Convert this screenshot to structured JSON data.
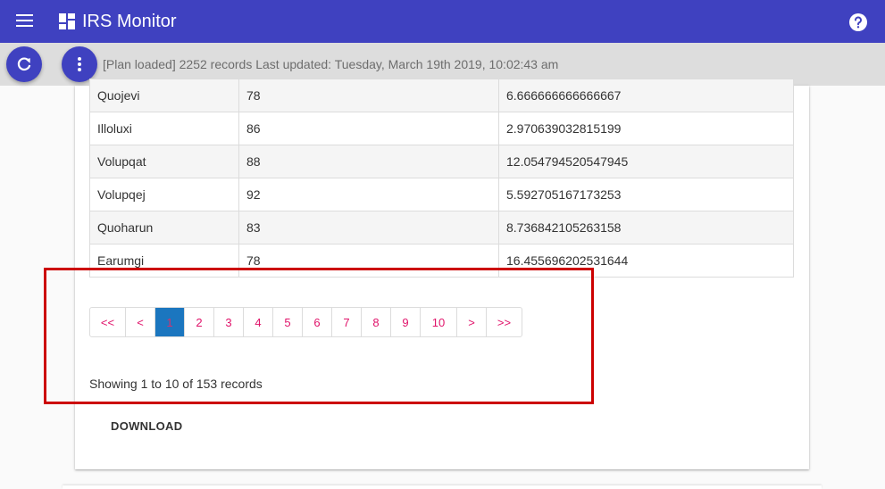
{
  "app": {
    "title": "IRS Monitor",
    "accent_color": "#3f41c0",
    "icons": {
      "menu": "menu-icon",
      "logo": "dashboard-icon",
      "help": "help-icon",
      "refresh": "refresh-icon",
      "more": "more-vert-icon"
    }
  },
  "status": {
    "text": "[Plan loaded] 2252 records Last updated: Tuesday, March 19th 2019, 10:02:43 am"
  },
  "table": {
    "rows": [
      [
        "Quojevi",
        "78",
        "6.666666666666667"
      ],
      [
        "Illoluxi",
        "86",
        "2.970639032815199"
      ],
      [
        "Volupqat",
        "88",
        "12.054794520547945"
      ],
      [
        "Volupqej",
        "92",
        "5.592705167173253"
      ],
      [
        "Quoharun",
        "83",
        "8.736842105263158"
      ],
      [
        "Earumgi",
        "78",
        "16.455696202531644"
      ]
    ]
  },
  "pagination": {
    "first": "<<",
    "prev": "<",
    "pages": [
      "1",
      "2",
      "3",
      "4",
      "5",
      "6",
      "7",
      "8",
      "9",
      "10"
    ],
    "current": "1",
    "next": ">",
    "last": ">>",
    "link_color": "#e0136a",
    "active_color": "#1b76bf"
  },
  "records_text": "Showing 1 to 10 of 153 records",
  "download_label": "DOWNLOAD",
  "highlight_color": "#cc0000"
}
